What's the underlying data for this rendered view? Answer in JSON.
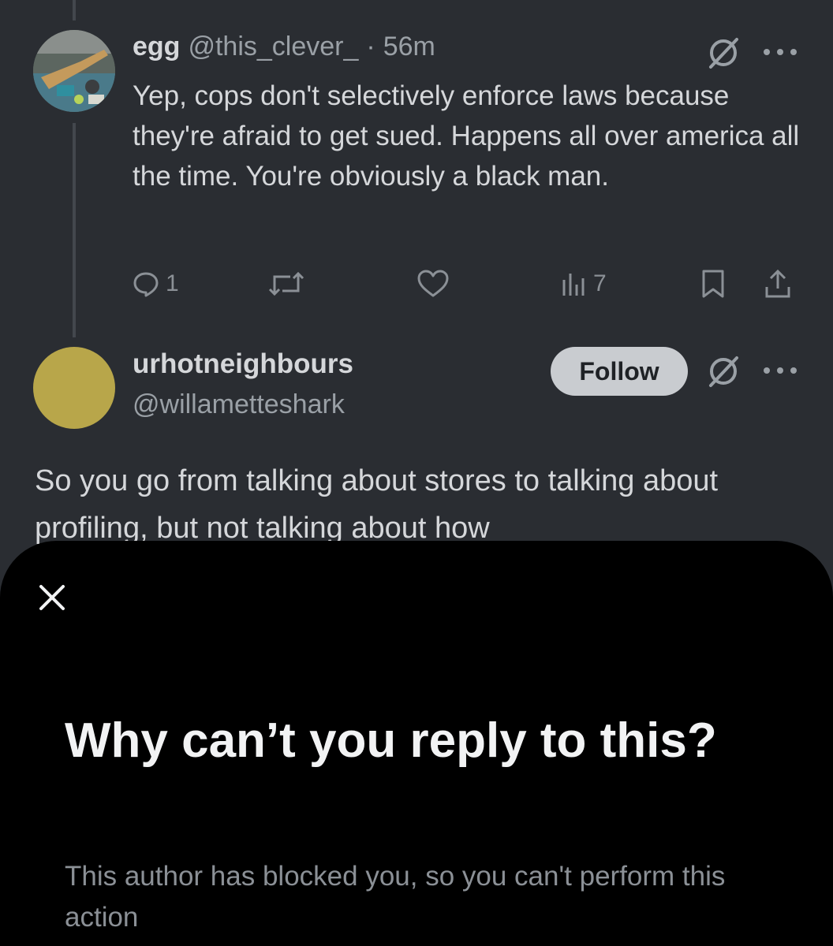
{
  "tweet1": {
    "display_name": "egg",
    "handle": "@this_clever_",
    "separator": "·",
    "time": "56m",
    "body": "Yep, cops don't selectively enforce laws because they're afraid to get sued. Happens all over america all the time. You're obviously a black man.",
    "actions": {
      "replies": "1",
      "views": "7"
    }
  },
  "tweet2": {
    "display_name": "urhotneighbours",
    "handle": "@willametteshark",
    "follow_label": "Follow",
    "body": "So you go from talking about stores to talking about profiling, but not talking about how"
  },
  "sheet": {
    "title": "Why can’t you reply to this?",
    "description": "This author has blocked you, so you can't perform this action"
  },
  "icons": {
    "reply": "reply-icon",
    "retweet": "retweet-icon",
    "like": "heart-icon",
    "views": "views-icon",
    "bookmark": "bookmark-icon",
    "share": "share-icon",
    "grok": "grok-icon",
    "more": "more-icon",
    "close": "close-icon"
  },
  "colors": {
    "background": "#2a2d32",
    "sheet": "#000000",
    "follow_button": "#c9ccd0",
    "muted_text": "#9aa0a6",
    "primary_text": "#d5d7da"
  }
}
